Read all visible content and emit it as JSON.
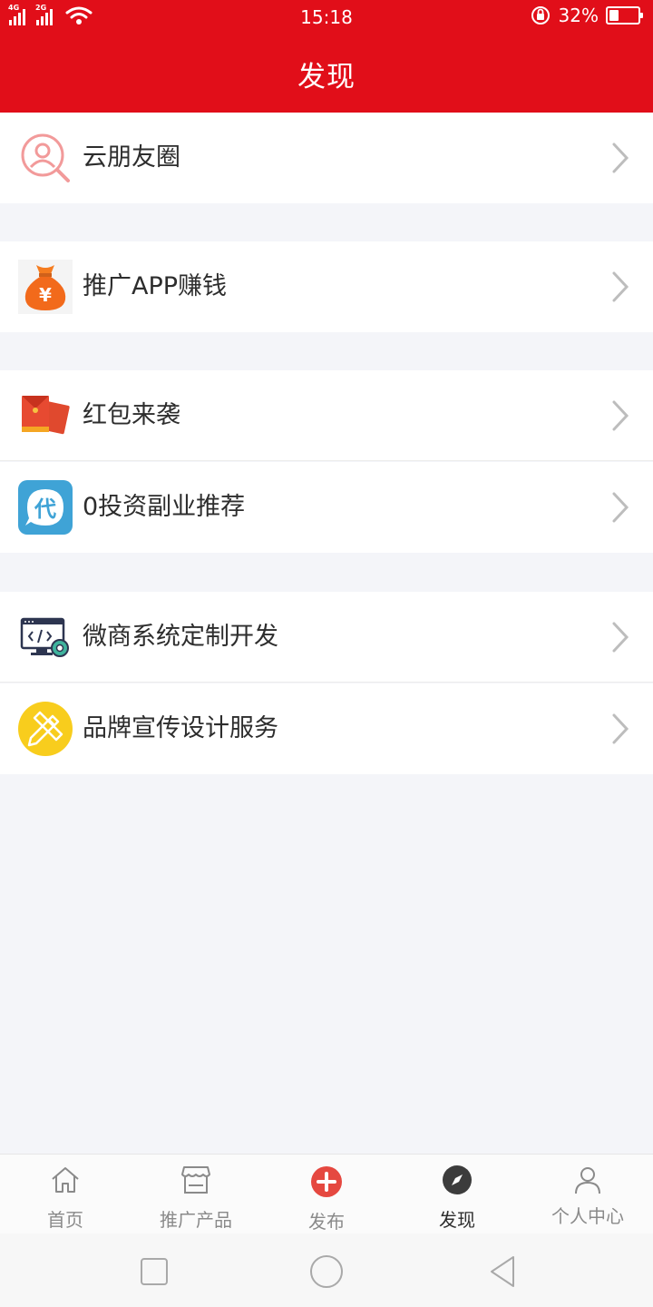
{
  "status_bar": {
    "network_1": "4G",
    "network_2": "2G",
    "time": "15:18",
    "battery_percent_label": "32%",
    "battery_level": 0.32,
    "icons": [
      "signal-icon",
      "wifi-icon",
      "rotation-lock-icon",
      "battery-icon"
    ]
  },
  "header": {
    "title": "发现"
  },
  "colors": {
    "brand_red": "#e10e19",
    "page_bg": "#f4f5f9",
    "chevron": "#bdbdbd"
  },
  "discover": {
    "items": [
      {
        "label": "云朋友圈",
        "icon": "cloud-friends-search-icon"
      },
      {
        "label": "推广APP赚钱",
        "icon": "money-bag-yuan-icon"
      },
      {
        "label": "红包来袭",
        "icon": "red-envelope-icon"
      },
      {
        "label": "0投资副业推荐",
        "icon": "dai-agent-icon"
      },
      {
        "label": "微商系统定制开发",
        "icon": "monitor-code-gear-icon"
      },
      {
        "label": "品牌宣传设计服务",
        "icon": "pencil-ruler-design-icon"
      }
    ]
  },
  "tabbar": {
    "tabs": [
      {
        "label": "首页",
        "icon": "home-icon",
        "active": false
      },
      {
        "label": "推广产品",
        "icon": "store-icon",
        "active": false
      },
      {
        "label": "发布",
        "icon": "add-circle-icon",
        "active": false
      },
      {
        "label": "发现",
        "icon": "compass-icon",
        "active": true
      },
      {
        "label": "个人中心",
        "icon": "person-icon",
        "active": false
      }
    ]
  },
  "system_nav": {
    "icons": [
      "recent-apps-icon",
      "home-circle-icon",
      "back-triangle-icon"
    ]
  }
}
